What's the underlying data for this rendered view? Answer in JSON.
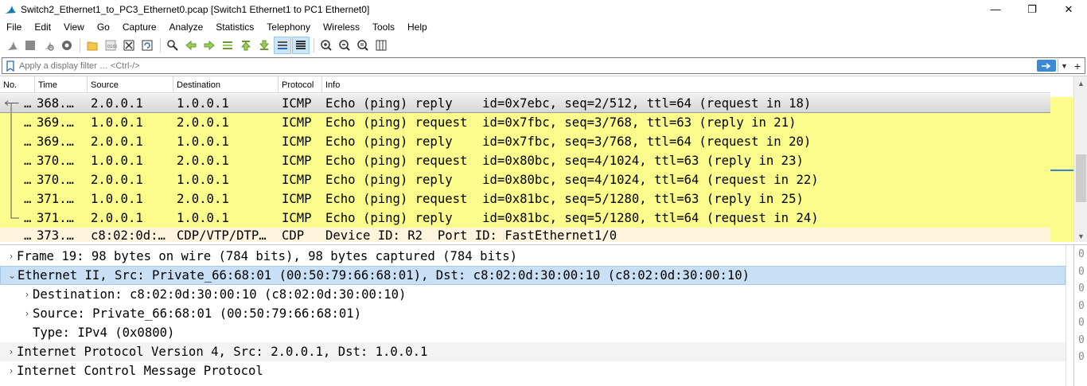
{
  "window": {
    "title": "Switch2_Ethernet1_to_PC3_Ethernet0.pcap [Switch1 Ethernet1 to PC1 Ethernet0]",
    "minimize": "—",
    "maximize": "❐",
    "close": "✕"
  },
  "menu": [
    "File",
    "Edit",
    "View",
    "Go",
    "Capture",
    "Analyze",
    "Statistics",
    "Telephony",
    "Wireless",
    "Tools",
    "Help"
  ],
  "filter": {
    "placeholder": "Apply a display filter … <Ctrl-/>",
    "value": ""
  },
  "packet_list": {
    "columns": [
      "No.",
      "Time",
      "Source",
      "Destination",
      "Protocol",
      "Info"
    ],
    "rows": [
      {
        "no": "…",
        "time": "368.…",
        "source": "2.0.0.1",
        "destination": "1.0.0.1",
        "protocol": "ICMP",
        "info": "Echo (ping) reply    id=0x7ebc, seq=2/512, ttl=64 (request in 18)",
        "state": "selected"
      },
      {
        "no": "…",
        "time": "369.…",
        "source": "1.0.0.1",
        "destination": "2.0.0.1",
        "protocol": "ICMP",
        "info": "Echo (ping) request  id=0x7fbc, seq=3/768, ttl=63 (reply in 21)",
        "state": "icmp"
      },
      {
        "no": "…",
        "time": "369.…",
        "source": "2.0.0.1",
        "destination": "1.0.0.1",
        "protocol": "ICMP",
        "info": "Echo (ping) reply    id=0x7fbc, seq=3/768, ttl=64 (request in 20)",
        "state": "icmp"
      },
      {
        "no": "…",
        "time": "370.…",
        "source": "1.0.0.1",
        "destination": "2.0.0.1",
        "protocol": "ICMP",
        "info": "Echo (ping) request  id=0x80bc, seq=4/1024, ttl=63 (reply in 23)",
        "state": "icmp"
      },
      {
        "no": "…",
        "time": "370.…",
        "source": "2.0.0.1",
        "destination": "1.0.0.1",
        "protocol": "ICMP",
        "info": "Echo (ping) reply    id=0x80bc, seq=4/1024, ttl=64 (request in 22)",
        "state": "icmp"
      },
      {
        "no": "…",
        "time": "371.…",
        "source": "1.0.0.1",
        "destination": "2.0.0.1",
        "protocol": "ICMP",
        "info": "Echo (ping) request  id=0x81bc, seq=5/1280, ttl=63 (reply in 25)",
        "state": "icmp"
      },
      {
        "no": "…",
        "time": "371.…",
        "source": "2.0.0.1",
        "destination": "1.0.0.1",
        "protocol": "ICMP",
        "info": "Echo (ping) reply    id=0x81bc, seq=5/1280, ttl=64 (request in 24)",
        "state": "icmp"
      },
      {
        "no": "…",
        "time": "373.…",
        "source": "c8:02:0d:…",
        "destination": "CDP/VTP/DTP…",
        "protocol": "CDP",
        "info": "Device ID: R2  Port ID: FastEthernet1/0",
        "state": "cdp"
      }
    ]
  },
  "details": [
    {
      "text": "Frame 19: 98 bytes on wire (784 bits), 98 bytes captured (784 bits)",
      "level": 0,
      "expanded": false,
      "state": "normal"
    },
    {
      "text": "Ethernet II, Src: Private_66:68:01 (00:50:79:66:68:01), Dst: c8:02:0d:30:00:10 (c8:02:0d:30:00:10)",
      "level": 0,
      "expanded": true,
      "state": "selected"
    },
    {
      "text": "Destination: c8:02:0d:30:00:10 (c8:02:0d:30:00:10)",
      "level": 1,
      "expanded": false,
      "state": "normal"
    },
    {
      "text": "Source: Private_66:68:01 (00:50:79:66:68:01)",
      "level": 1,
      "expanded": false,
      "state": "normal"
    },
    {
      "text": "Type: IPv4 (0x0800)",
      "level": 1,
      "leaf": true,
      "state": "normal"
    },
    {
      "text": "Internet Protocol Version 4, Src: 2.0.0.1, Dst: 1.0.0.1",
      "level": 0,
      "expanded": false,
      "state": "alt"
    },
    {
      "text": "Internet Control Message Protocol",
      "level": 0,
      "expanded": false,
      "state": "normal"
    }
  ],
  "bytes_pane": [
    "0",
    "0",
    "0",
    "0",
    "0",
    "0",
    "0"
  ],
  "colors": {
    "icmp_row": "#fcfc8c",
    "cdp_row": "#fff5dc",
    "selected_detail": "#c8dff5",
    "accent": "#3c8ad6"
  }
}
